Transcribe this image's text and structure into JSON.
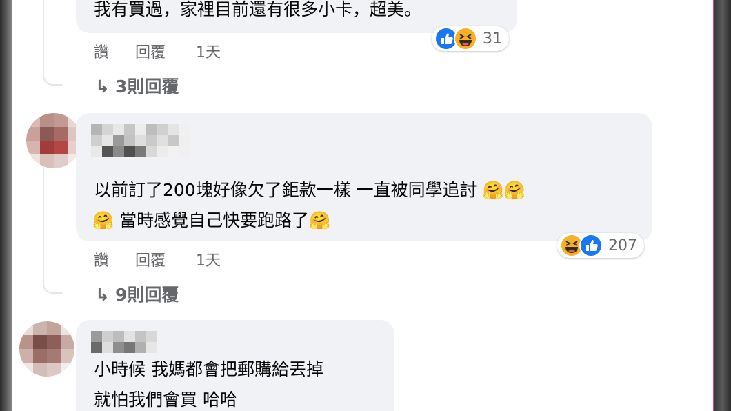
{
  "colors": {
    "bubble_bg": "#f0f2f5",
    "secondary_text": "#65676b",
    "like_blue": "#1877f2",
    "haha_yellow": "#f7b125"
  },
  "comments": [
    {
      "text_lines": [
        "我有買過，家裡目前還有很多小卡，超美。"
      ],
      "actions": {
        "like": "讚",
        "reply": "回覆",
        "time": "1天"
      },
      "reactions": {
        "icons": [
          "like-icon",
          "haha-icon"
        ],
        "count": "31"
      },
      "view_replies": "3則回覆"
    },
    {
      "text_lines": [
        "以前訂了200塊好像欠了鉅款一樣 一直被同學追討",
        "當時感覺自己快要跑路了"
      ],
      "actions": {
        "like": "讚",
        "reply": "回覆",
        "time": "1天"
      },
      "reactions": {
        "icons": [
          "haha-icon",
          "like-icon"
        ],
        "count": "207"
      },
      "view_replies": "9則回覆"
    },
    {
      "text_lines": [
        "小時候 我媽都會把郵購給丟掉",
        "就怕我們會買 哈哈"
      ]
    }
  ]
}
